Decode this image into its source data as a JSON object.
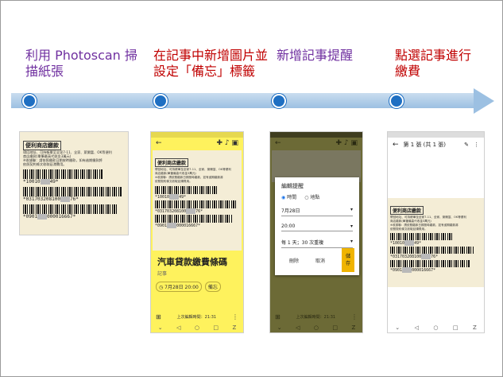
{
  "steps": [
    {
      "label_line1": "利用 Photoscan 掃",
      "label_line2": "描紙張",
      "color": "#7030a0"
    },
    {
      "label_line1": "在記事中新增圖片並",
      "label_line2": "設定「備忘」標籤",
      "color": "#c00000"
    },
    {
      "label_line1": "新增記事提醒",
      "label_line2": "",
      "color": "#7030a0"
    },
    {
      "label_line1": "點選記事進行",
      "label_line2": "繳費",
      "color": "#c00000"
    }
  ],
  "receipt": {
    "title": "便利商店繳款",
    "line1": "帶回地址、可持帳單至全家7-11、全家、萊爾富、OK等便利",
    "line2": "商店繳款(單筆最高代收金3萬元)",
    "line3": "※收據聯：請依照繳款日期按時繳款，如有逾期繳款將",
    "line4": "依照契約條文收取延滯費用。",
    "code1": "*10010",
    "code1b": "49*",
    "code2": "*031703208100",
    "code2b": "76*",
    "code3": "*0901",
    "code3b": "000016667*"
  },
  "phone2": {
    "note_title": "汽車貸款繳費條碼",
    "note_sub": "記事",
    "reminder": "7月28日 20:00",
    "label_chip": "備忘",
    "edited": "上次編輯時間：21:31"
  },
  "phone3": {
    "dialog_title": "編輯提醒",
    "opt_time": "時間",
    "opt_place": "地點",
    "date": "7月28日",
    "time": "20:00",
    "repeat": "每 1 天；30 次重複",
    "btn_delete": "刪除",
    "btn_cancel": "取消",
    "btn_save": "儲存",
    "edited": "上次編輯時間：21:31"
  },
  "phone4": {
    "header": "第 1 張 (共 1 張)"
  },
  "colors": {
    "arrow": "#9cc0e2",
    "dot": "#1f6fc2",
    "keep_yellow": "#fef25d",
    "dark_olive": "#6c6a36",
    "save_orange": "#f0b400"
  }
}
